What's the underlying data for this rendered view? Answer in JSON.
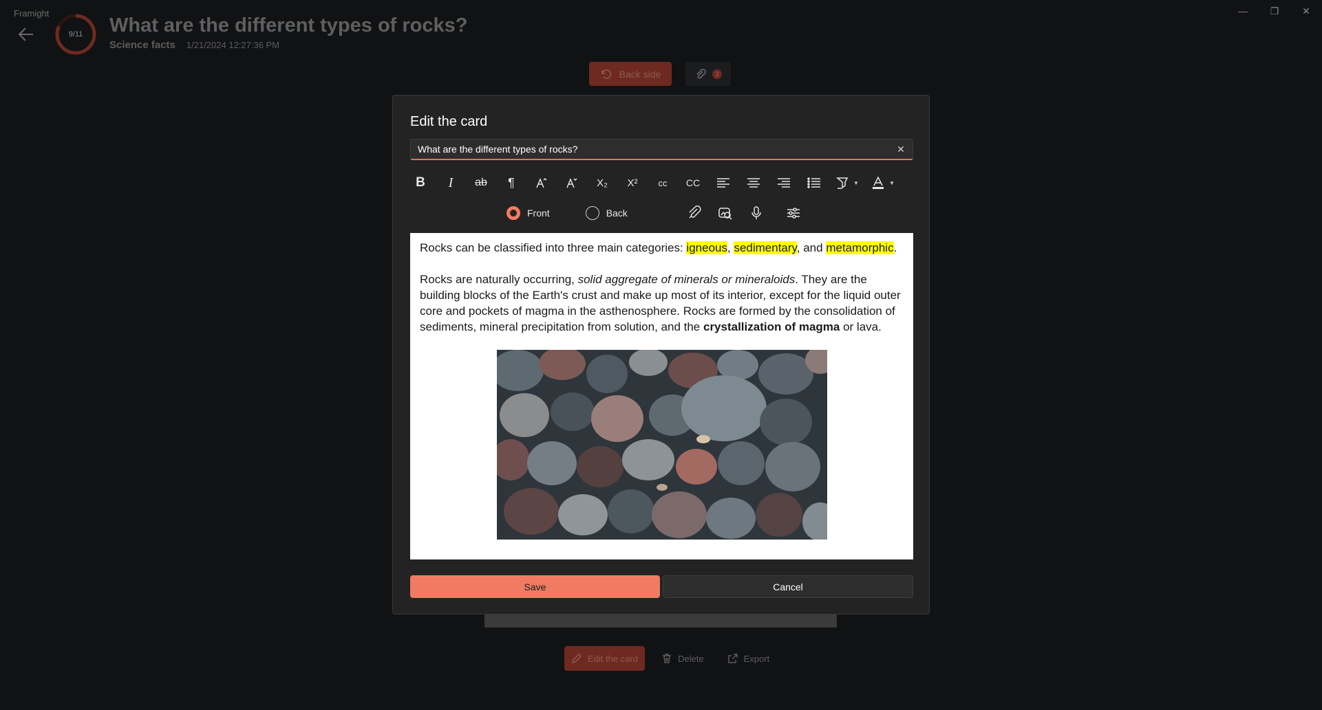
{
  "app": {
    "name": "Framight"
  },
  "window": {
    "minimize": "—",
    "maximize": "❐",
    "close": "✕"
  },
  "header": {
    "progress_label": "9/11",
    "progress": 0.82,
    "title": "What are the different types of rocks?",
    "deck": "Science facts",
    "date": "1/21/2024 12:27:36 PM"
  },
  "card_actions": {
    "side_label": "Back side",
    "attachment_count": "3"
  },
  "bottom_bar": {
    "edit_label": "Edit the card",
    "delete_label": "Delete",
    "export_label": "Export"
  },
  "modal": {
    "title": "Edit the card",
    "question_value": "What are the different types of rocks?",
    "toolbar": {
      "bold": "B",
      "italic": "I",
      "strikethrough": "ab",
      "subscript": "X₂",
      "superscript": "X²",
      "lowercase": "cc",
      "uppercase": "CC"
    },
    "side": {
      "front_label": "Front",
      "back_label": "Back",
      "selected": "Front"
    },
    "content": {
      "p1_prefix": "Rocks can be classified into three main categories: ",
      "cat1": "igneous",
      "sep1": ", ",
      "cat2": "sedimentary",
      "sep2": ", and ",
      "cat3": "metamorphic",
      "p1_end": ".",
      "p2_a": "Rocks are naturally occurring, ",
      "p2_italic": "solid aggregate of minerals or mineraloids",
      "p2_b": ". They are the building blocks of the Earth's crust and make up most of its interior, except for the liquid outer core and pockets of magma in the asthenosphere. Rocks are formed by the consolidation of sediments, mineral precipitation from solution, and the ",
      "p2_bold": "crystallization of magma",
      "p2_c": " or lava."
    },
    "save_label": "Save",
    "cancel_label": "Cancel"
  },
  "colors": {
    "accent": "#f07b62",
    "highlight": "#ffff00",
    "modal_bg": "#232323",
    "page_bg": "#111214"
  }
}
